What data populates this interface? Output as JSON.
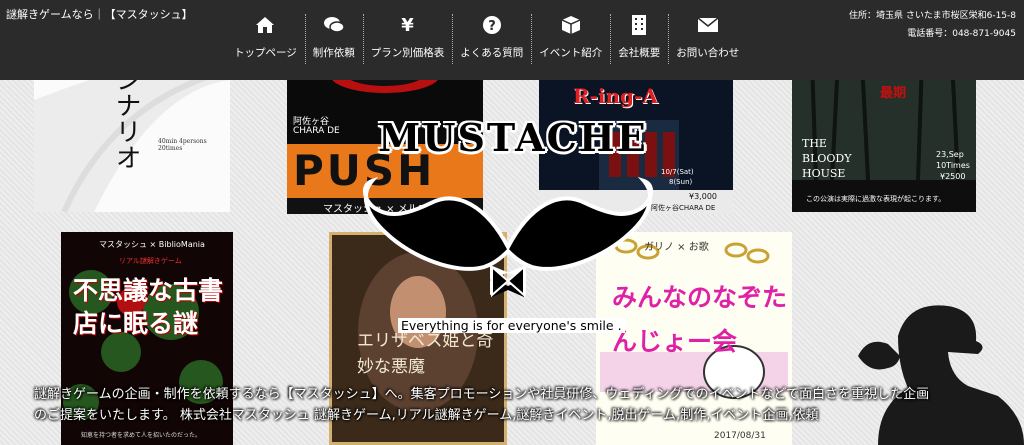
{
  "header": {
    "site_title": "謎解きゲームなら｜【マスタッシュ】",
    "address": "住所：埼玉県 さいたま市桜区栄和6-15-8",
    "phone": "電話番号：048-871-9045"
  },
  "nav": [
    {
      "label": "トップページ",
      "icon": "home-icon"
    },
    {
      "label": "制作依頼",
      "icon": "chat-icon"
    },
    {
      "label": "プラン別価格表",
      "icon": "yen-icon"
    },
    {
      "label": "よくある質問",
      "icon": "question-icon"
    },
    {
      "label": "イベント紹介",
      "icon": "box-icon"
    },
    {
      "label": "会社概要",
      "icon": "building-icon"
    },
    {
      "label": "お問い合わせ",
      "icon": "mail-icon"
    }
  ],
  "posters": {
    "p1": {
      "big": "シナリオ",
      "small": "40min 4persons 20times"
    },
    "p2": {
      "top": "阿佐ヶ谷",
      "mid": "CHARA DE",
      "title": "PUSH",
      "bottom": "マスタッシュ × メルエ"
    },
    "p3": {
      "title": "R-ing-A",
      "date": "10/7(Sat)",
      "date2": "8(Sun)",
      "price": "¥3,000",
      "venue": "阿佐ヶ谷CHARA DE"
    },
    "p4": {
      "title": "最期",
      "name": "THE BLOODY HOUSE",
      "date": "23,Sep",
      "times": "10Times",
      "price": "¥2500",
      "note": "この公演は実際に過激な表現が起こります。"
    },
    "p5": {
      "header": "マスタッシュ × BiblioMania",
      "sub": "リアル謎解きゲーム",
      "title": "不思議な古書店に眠る謎",
      "footer": "知恵を持つ者を求めて人を招いたのだった。"
    },
    "p6": {
      "title": "エリザベス姫と奇妙な悪魔"
    },
    "p7": {
      "header": "ガリノ × お歌",
      "title": "みんなのなぞたんじょー会",
      "date": "2017/08/31"
    }
  },
  "logo": {
    "text": "MUSTACHE",
    "tagline": "Everything is for everyone's smile ."
  },
  "description": {
    "line1": "謎解きゲームの企画・制作を依頼するなら【マスタッシュ】へ。集客プロモーションや社員研修、ウェディングでのイベントなどで面白さを重視した企画",
    "line2": "のご提案をいたします。 株式会社マスタッシュ 謎解きゲーム,リアル謎解きゲーム,謎解きイベント,脱出ゲーム,制作,イベント企画,依頼"
  }
}
